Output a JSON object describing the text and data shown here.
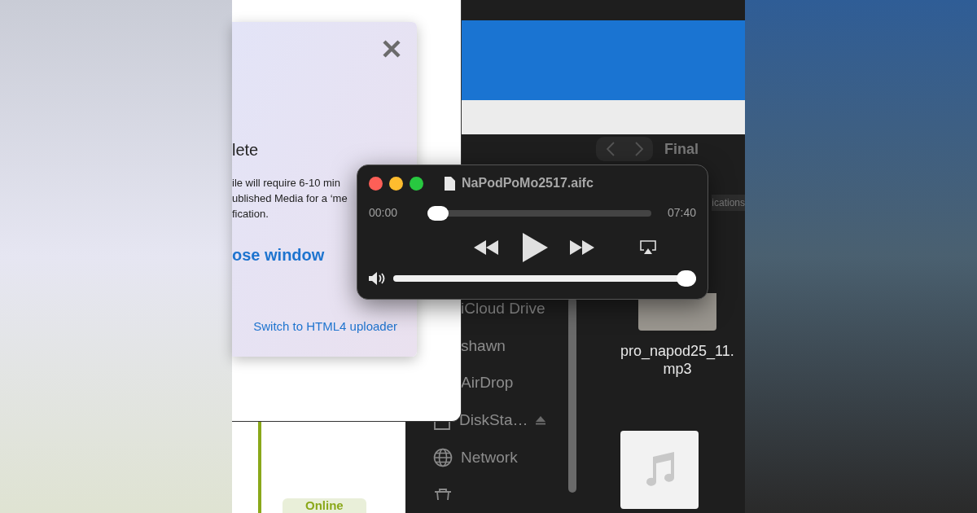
{
  "upload_dialog": {
    "heading": "lete",
    "body_lines": [
      "ile will require 6-10 min",
      "ublished Media for a ‘me",
      "fication."
    ],
    "close_link": "ose window",
    "switch_link": "Switch to HTML4 uploader"
  },
  "status_badge": "Online",
  "player": {
    "title": "NaPodPoMo2517.aifc",
    "elapsed": "00:00",
    "duration": "07:40",
    "position": {
      "level": 0
    },
    "volume": {
      "level": 1
    }
  },
  "finder": {
    "title": "Final",
    "tab": "ications",
    "sidebar": [
      {
        "kind": "plain",
        "label": "iCloud Drive"
      },
      {
        "kind": "plain",
        "label": "shawn"
      },
      {
        "kind": "plain",
        "label": "AirDrop"
      },
      {
        "kind": "disk",
        "label": "DiskSta…"
      },
      {
        "kind": "network",
        "label": "Network"
      },
      {
        "kind": "trash"
      }
    ],
    "files": [
      {
        "kind": "image",
        "name": "pro_napod25_11.mp3"
      },
      {
        "kind": "audio"
      }
    ]
  }
}
